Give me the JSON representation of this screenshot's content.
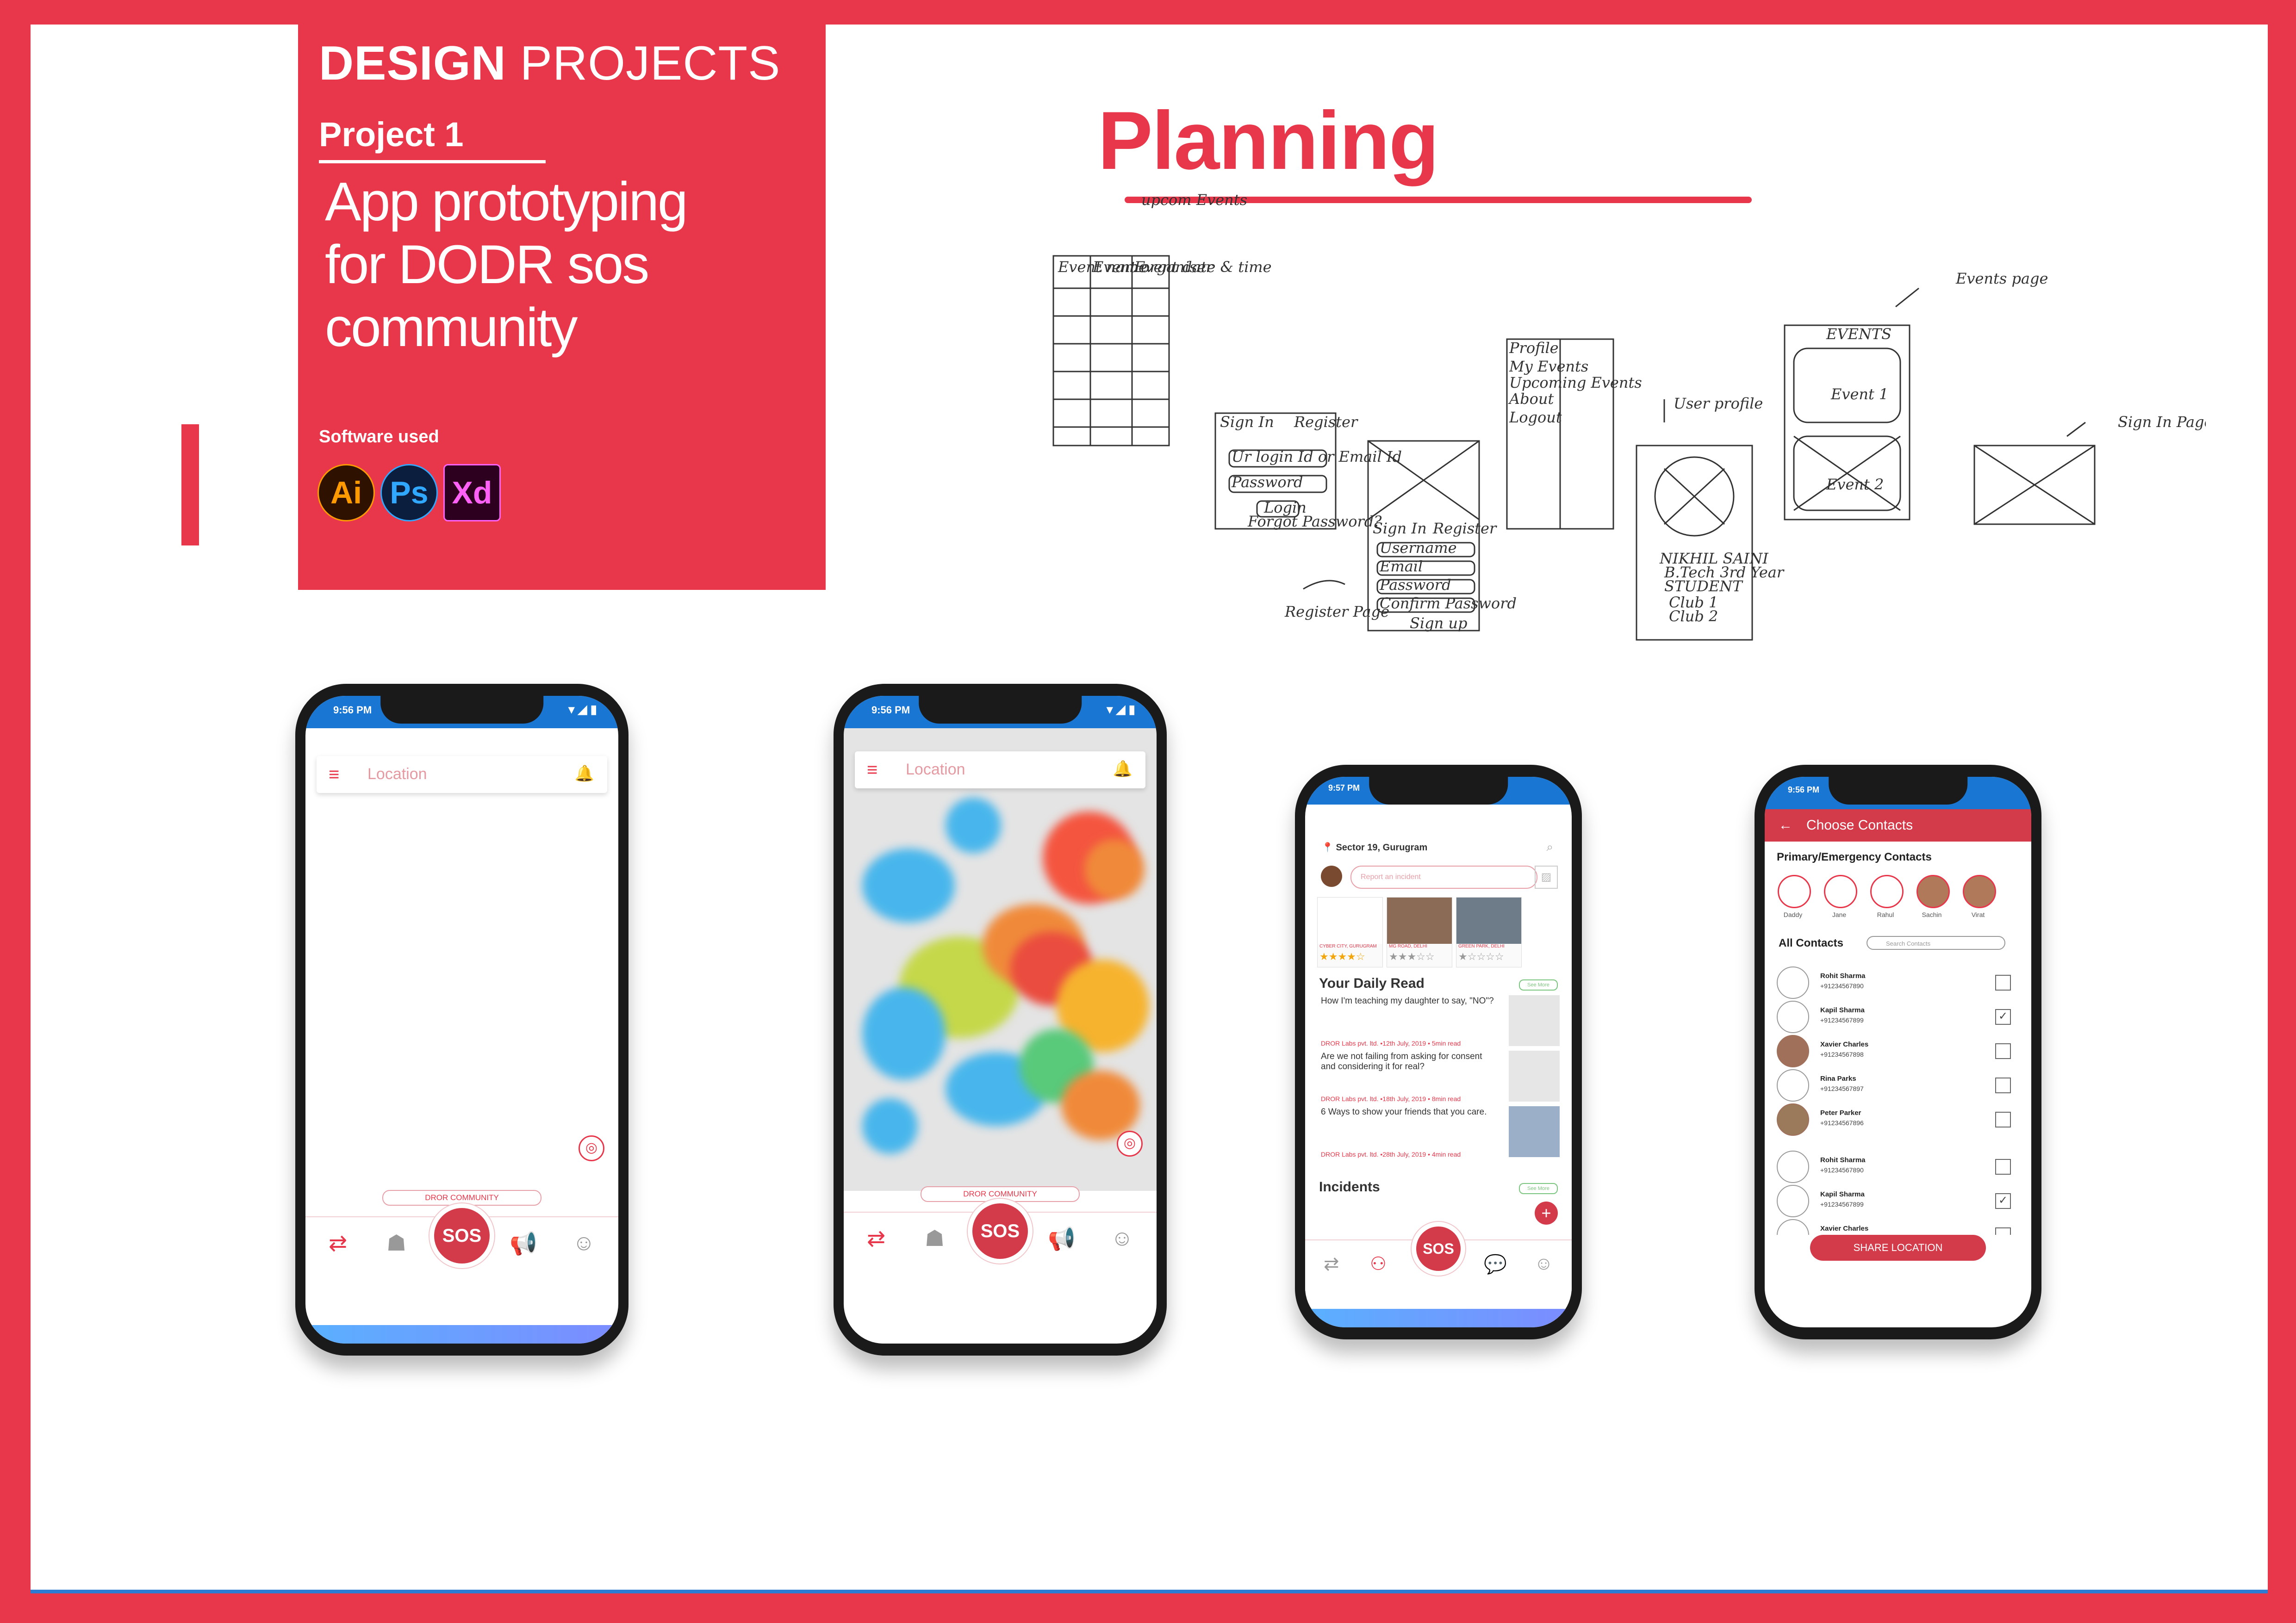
{
  "header": {
    "title_bold": "DESIGN",
    "title_rest": " PROJECTS",
    "project": "Project 1",
    "subtitle_lines": [
      "App prototyping",
      "for DODR sos",
      "community"
    ],
    "software_label": "Software used",
    "software": [
      "Ai",
      "Ps",
      "Xd"
    ]
  },
  "planning": {
    "title": "Planning",
    "sketch_notes": {
      "upcoming": "upcom Events",
      "events_page": "Events page",
      "user_profile": "User profile",
      "sign_in_page": "Sign In Page",
      "register_page": "Register Page",
      "event_name": "Event name",
      "event_organiser": "Event organiser",
      "event_date": "Event date & time",
      "sign_in": "Sign In",
      "register": "Register",
      "login_field": "Ur login Id or Email Id",
      "password": "Password",
      "login_btn": "Login",
      "forgot": "Forgot Password?",
      "profile": "Profile",
      "my_events": "My Events",
      "upcoming_events": "Upcoming Events",
      "about": "About",
      "logout": "Logout",
      "username": "Username",
      "email": "Email",
      "confirm_password": "Confirm Password",
      "signup": "Sign up",
      "events": "EVENTS",
      "event1": "Event 1",
      "event2": "Event 2",
      "profile_name": "NIKHIL SAINI",
      "profile_edu": "B.Tech 3rd Year",
      "profile_role": "STUDENT",
      "club1": "Club 1",
      "club2": "Club 2"
    }
  },
  "phone1": {
    "time": "9:56 PM",
    "location": "Location",
    "pill": "DROR COMMUNITY",
    "sos": "SOS"
  },
  "phone2": {
    "time": "9:56 PM",
    "location": "Location",
    "pill": "DROR COMMUNITY",
    "sos": "SOS"
  },
  "phone3": {
    "time": "9:57 PM",
    "location": "Sector 19, Gurugram",
    "report_placeholder": "Report an incident",
    "cards": [
      {
        "label": "CYBER CITY, GURUGRAM",
        "stars": "★★★★☆"
      },
      {
        "label": "MG ROAD, DELHI",
        "stars": "★★★☆☆"
      },
      {
        "label": "GREEN PARK, DELHI",
        "stars": "★☆☆☆☆"
      }
    ],
    "daily_read_title": "Your Daily Read",
    "see_more": "See More",
    "articles": [
      {
        "title": "How I'm teaching my daughter to say, \"NO\"?",
        "meta": "DROR Labs pvt. ltd. •12th July, 2019 • 5min read"
      },
      {
        "title": "Are we not failing from asking for consent and considering it for real?",
        "meta": "DROR Labs pvt. ltd. •18th July, 2019 • 8min read"
      },
      {
        "title": "6 Ways to show your friends that you care.",
        "meta": "DROR Labs pvt. ltd. •28th July, 2019 • 4min read"
      }
    ],
    "incidents_title": "Incidents",
    "sos": "SOS"
  },
  "phone4": {
    "time": "9:56 PM",
    "title": "Choose Contacts",
    "primary_title": "Primary/Emergency Contacts",
    "primary": [
      "Daddy",
      "Jane",
      "Rahul",
      "Sachin",
      "Virat"
    ],
    "all_title": "All Contacts",
    "search_placeholder": "Search Contacts",
    "contacts": [
      {
        "name": "Rohit Sharma",
        "phone": "+91234567890",
        "checked": ""
      },
      {
        "name": "Kapil Sharma",
        "phone": "+91234567899",
        "checked": "✓"
      },
      {
        "name": "Xavier Charles",
        "phone": "+91234567898",
        "checked": ""
      },
      {
        "name": "Rina Parks",
        "phone": "+91234567897",
        "checked": ""
      },
      {
        "name": "Peter Parker",
        "phone": "+91234567896",
        "checked": ""
      },
      {
        "name": "Rohit Sharma",
        "phone": "+91234567890",
        "checked": ""
      },
      {
        "name": "Kapil Sharma",
        "phone": "+91234567899",
        "checked": "✓"
      },
      {
        "name": "Xavier Charles",
        "phone": "",
        "checked": ""
      }
    ],
    "share": "SHARE LOCATION"
  },
  "colors": {
    "brand": "#e8374a",
    "statusbar": "#1976d2"
  }
}
